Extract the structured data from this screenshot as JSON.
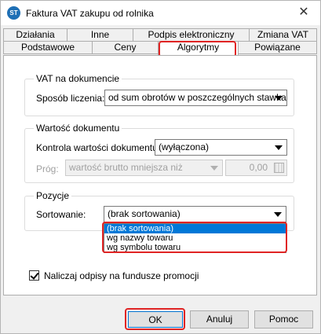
{
  "window": {
    "title": "Faktura VAT zakupu od rolnika",
    "app_icon_text": "ST"
  },
  "tabs_row1": [
    "Działania",
    "Inne",
    "Podpis elektroniczny",
    "Zmiana VAT"
  ],
  "tabs_row2": [
    "Podstawowe",
    "Ceny",
    "Algorytmy",
    "Powiązane"
  ],
  "active_tab": "Algorytmy",
  "highlight_color": "#e02424",
  "vat_group": {
    "legend": "VAT na dokumencie",
    "method_label": "Sposób liczenia:",
    "method_value": "od sum obrotów w poszczególnych stawkach"
  },
  "value_group": {
    "legend": "Wartość dokumentu",
    "control_label": "Kontrola wartości dokumentu:",
    "control_value": "(wyłączona)",
    "threshold_label": "Próg:",
    "threshold_type_value": "wartość brutto mniejsza niż",
    "threshold_amount": "0,00"
  },
  "items_group": {
    "legend": "Pozycje",
    "sort_label": "Sortowanie:",
    "sort_value": "(brak sortowania)",
    "sort_options": [
      "(brak sortowania)",
      "wg nazwy towaru",
      "wg symbolu towaru"
    ],
    "selected_option": 0
  },
  "promo_checkbox": {
    "label": "Naliczaj odpisy na fundusze promocji",
    "checked": true
  },
  "buttons": {
    "ok": "OK",
    "cancel": "Anuluj",
    "help": "Pomoc"
  }
}
